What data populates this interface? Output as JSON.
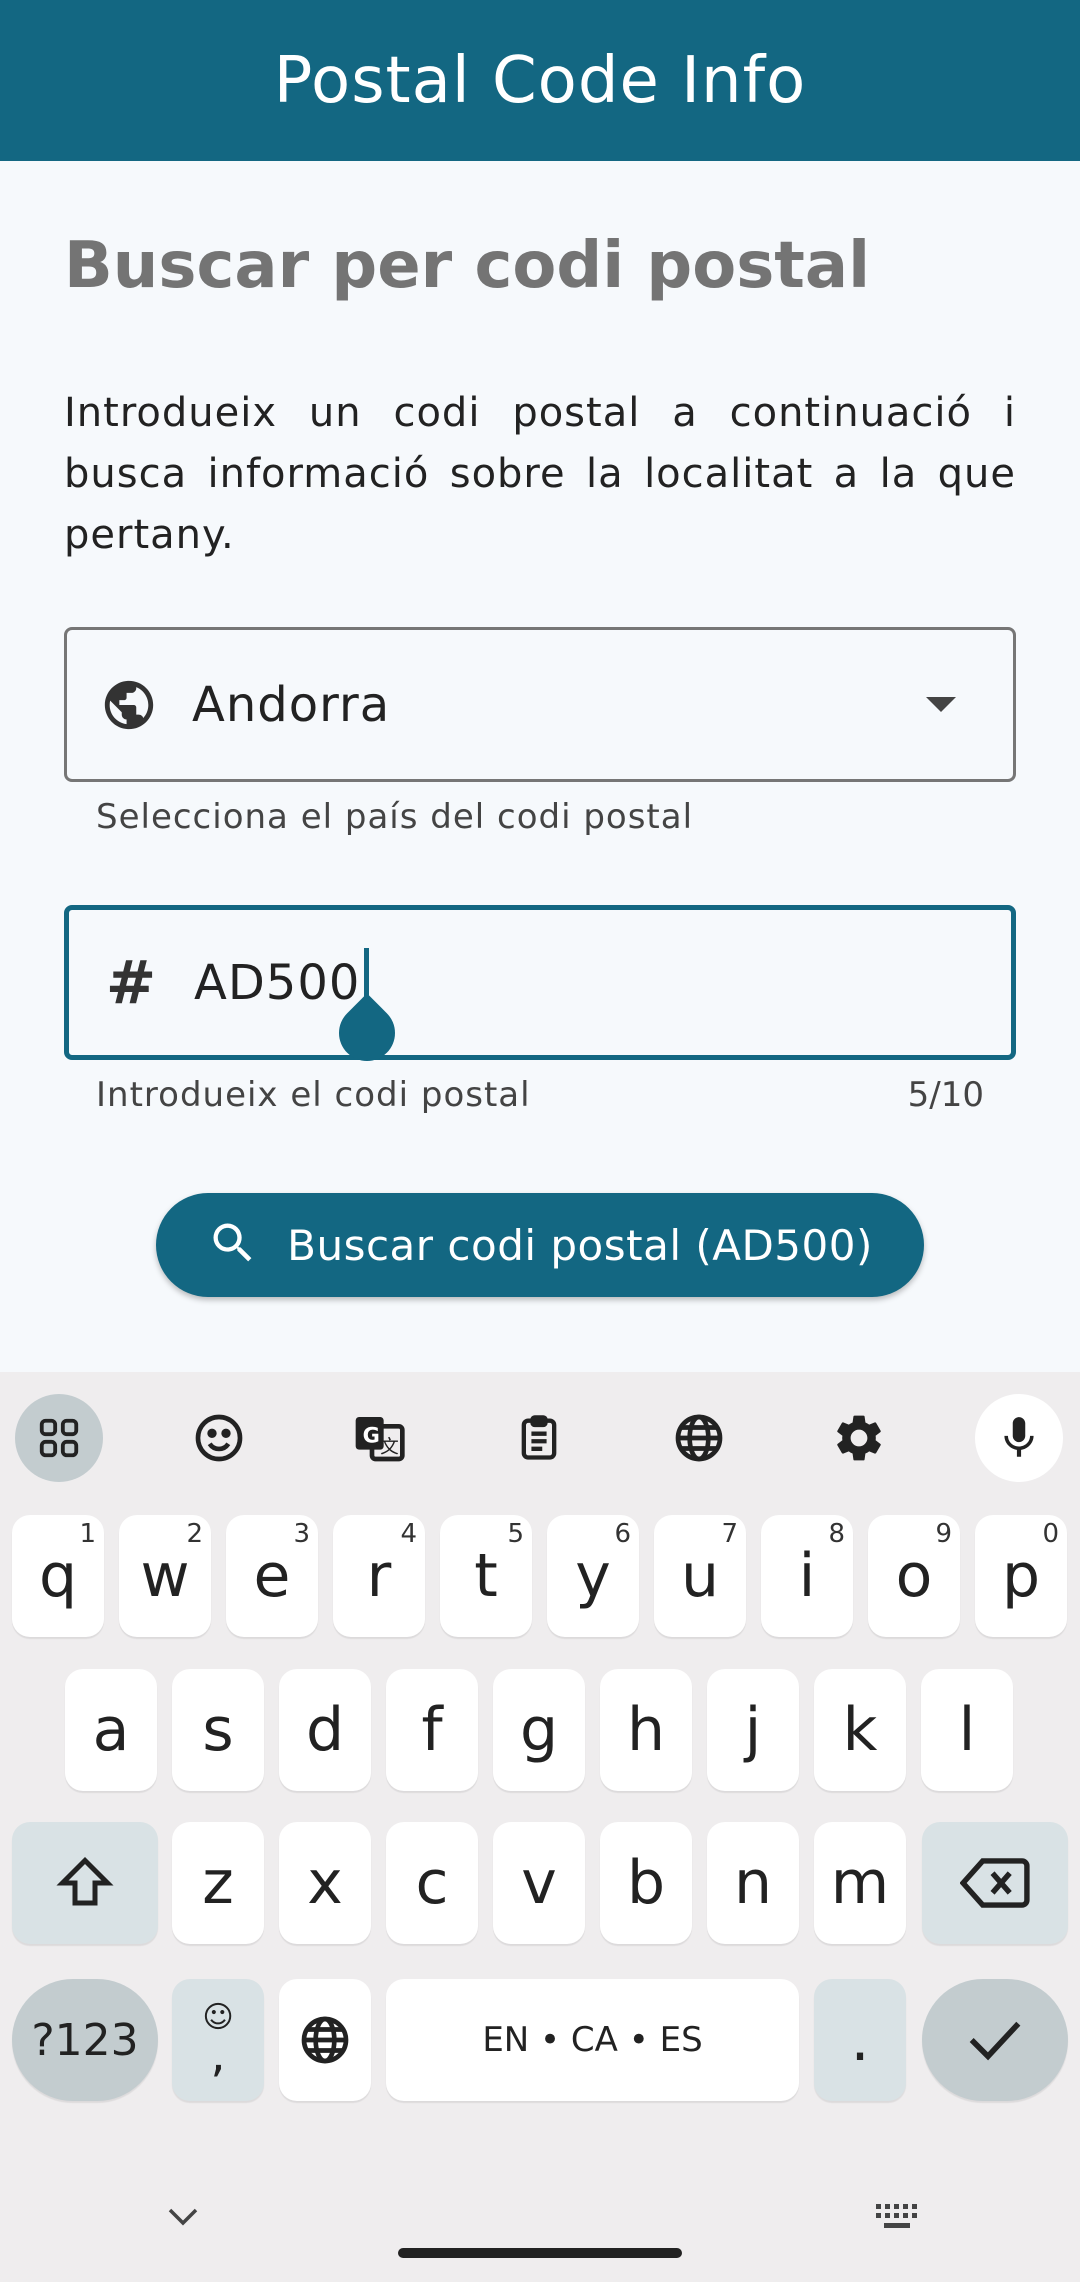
{
  "appbar": {
    "title": "Postal Code Info"
  },
  "main": {
    "heading": "Buscar per codi postal",
    "intro": "Introdueix un codi postal a continuació i busca informació sobre la localitat a la que pertany.",
    "country_field": {
      "value": "Andorra",
      "helper": "Selecciona el país del codi postal",
      "icon": "globe-icon"
    },
    "code_field": {
      "value": "AD500",
      "helper": "Introdueix el codi postal",
      "counter": "5/10",
      "icon": "hash-icon"
    },
    "search_button": {
      "label": "Buscar codi postal (AD500)",
      "icon": "search-icon"
    }
  },
  "keyboard": {
    "toolbar": [
      "apps-icon",
      "emoji-icon",
      "translate-icon",
      "clipboard-icon",
      "globe-icon",
      "settings-icon",
      "mic-icon"
    ],
    "row1": [
      {
        "k": "q",
        "s": "1"
      },
      {
        "k": "w",
        "s": "2"
      },
      {
        "k": "e",
        "s": "3"
      },
      {
        "k": "r",
        "s": "4"
      },
      {
        "k": "t",
        "s": "5"
      },
      {
        "k": "y",
        "s": "6"
      },
      {
        "k": "u",
        "s": "7"
      },
      {
        "k": "i",
        "s": "8"
      },
      {
        "k": "o",
        "s": "9"
      },
      {
        "k": "p",
        "s": "0"
      }
    ],
    "row2": [
      "a",
      "s",
      "d",
      "f",
      "g",
      "h",
      "j",
      "k",
      "l"
    ],
    "row3": [
      "z",
      "x",
      "c",
      "v",
      "b",
      "n",
      "m"
    ],
    "symbols_label": "?123",
    "comma_label": ",",
    "space_label": "EN • CA • ES",
    "period_label": "."
  },
  "colors": {
    "primary": "#136782",
    "background": "#f6f9fc",
    "keyboard_bg": "#efedee"
  }
}
